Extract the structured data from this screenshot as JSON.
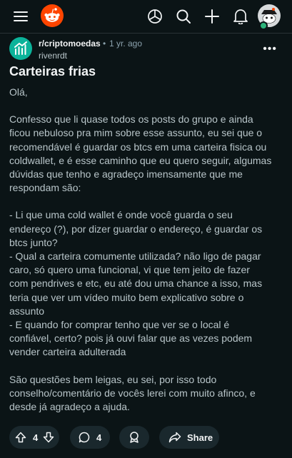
{
  "header": {
    "menu_icon": "hamburger-menu-icon",
    "logo_icon": "reddit-snoo-logo",
    "popular_icon": "popular-icon",
    "search_icon": "search-icon",
    "create_icon": "plus-icon",
    "notifications_icon": "bell-icon",
    "avatar_icon": "user-avatar"
  },
  "post": {
    "subreddit": "r/criptomoedas",
    "age": "1 yr. ago",
    "author": "rivenrdt",
    "title": "Carteiras frias",
    "paragraphs": [
      [
        "Olá,"
      ],
      [
        "Confesso que li quase todos os posts do grupo e ainda",
        "ficou nebuloso pra mim sobre esse assunto, eu sei que o",
        "recomendável é guardar os btcs em uma carteira fisica ou",
        "coldwallet, e é esse caminho que eu quero seguir, algumas",
        "dúvidas que tenho e agradeço imensamente que me",
        "respondam são:"
      ],
      [
        "- Li que uma cold wallet é onde você guarda o seu",
        "endereço (?), por dizer guardar o endereço, é guardar os",
        "btcs junto?",
        "- Qual a carteira comumente utilizada? não ligo de pagar",
        "caro, só quero uma funcional, vi que tem jeito de fazer",
        "com pendrives e etc, eu até dou uma chance a isso, mas",
        "teria que ver um vídeo muito bem explicativo sobre o",
        "assunto",
        "- E quando for comprar tenho que ver se o local é",
        "confiável, certo? pois já ouvi falar que as vezes podem",
        "vender carteira adulterada"
      ],
      [
        "São questões bem leigas, eu sei, por isso todo",
        "conselho/comentário de vocês lerei com muito afinco, e",
        "desde já agradeço a ajuda."
      ]
    ],
    "vote_count": "4",
    "comment_count": "4",
    "share_label": "Share"
  },
  "colors": {
    "background": "#0b1416",
    "pill": "#1a282d",
    "accent": "#ff4500",
    "subreddit_icon": "#0bb39a"
  }
}
